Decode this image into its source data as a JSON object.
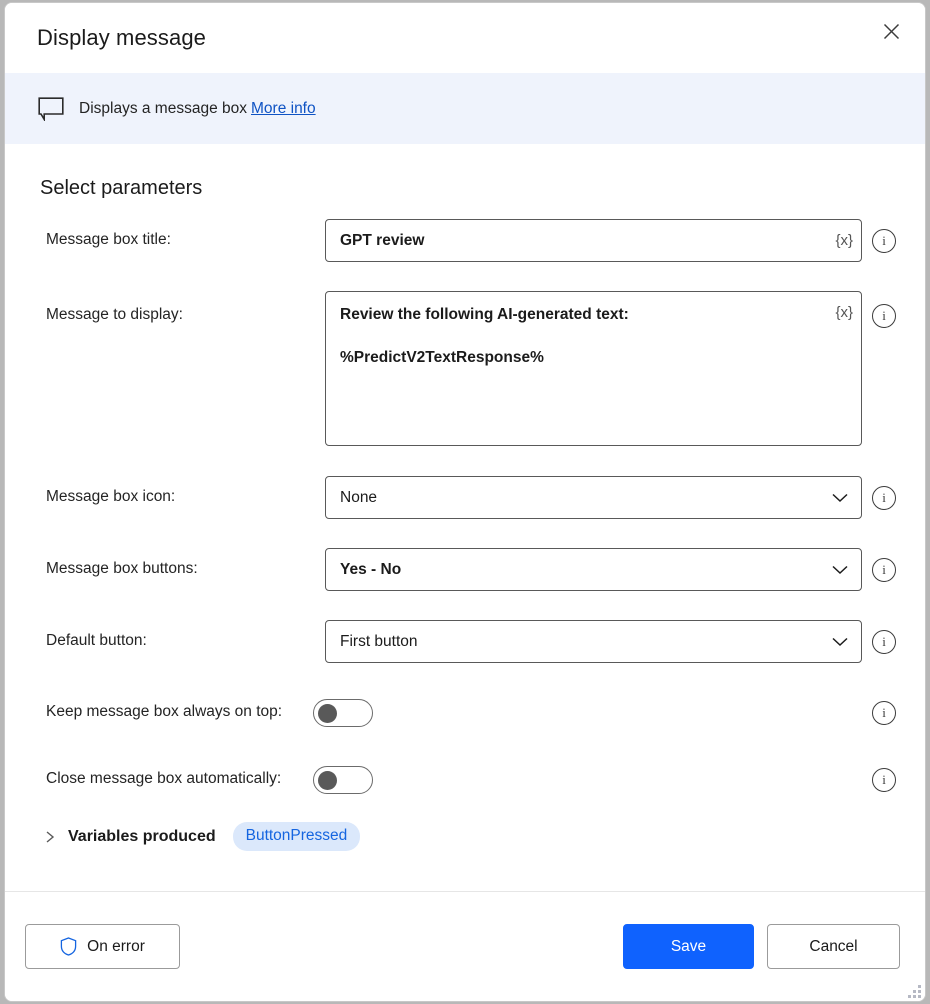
{
  "window": {
    "title": "Display message",
    "close_icon": "close-icon"
  },
  "info_bar": {
    "icon": "message-bubble-icon",
    "text": "Displays a message box",
    "link_label": "More info",
    "link_color": "#0f53c4",
    "background": "#eff3fc"
  },
  "main": {
    "section_title": "Select parameters",
    "fields": [
      {
        "label": "Message box title:",
        "type": "text",
        "value": "GPT review",
        "variable_button": "{x}",
        "info_icon": "info-icon"
      },
      {
        "label": "Message to display:",
        "type": "textarea",
        "value": "Review the following AI-generated text:\n\n%PredictV2TextResponse%",
        "variable_button": "{x}",
        "info_icon": "info-icon"
      },
      {
        "label": "Message box icon:",
        "type": "dropdown",
        "value": "None",
        "bold": false,
        "info_icon": "info-icon"
      },
      {
        "label": "Message box buttons:",
        "type": "dropdown",
        "value": "Yes - No",
        "bold": true,
        "info_icon": "info-icon"
      },
      {
        "label": "Default button:",
        "type": "dropdown",
        "value": "First button",
        "bold": false,
        "info_icon": "info-icon"
      },
      {
        "label": "Keep message box always on top:",
        "type": "toggle",
        "value": "off",
        "info_icon": "info-icon"
      },
      {
        "label": "Close message box automatically:",
        "type": "toggle",
        "value": "off",
        "info_icon": "info-icon"
      }
    ],
    "variables_produced": {
      "expander_icon": "chevron-right-icon",
      "title": "Variables produced",
      "pill_label": "ButtonPressed",
      "pill_bg": "#dbe8fb",
      "pill_color": "#1565e0"
    }
  },
  "footer": {
    "on_error_label": "On error",
    "on_error_icon": "shield-icon",
    "save_label": "Save",
    "cancel_label": "Cancel",
    "save_color": "#0f62fe",
    "resize_grip": "resize-grip-icon"
  }
}
